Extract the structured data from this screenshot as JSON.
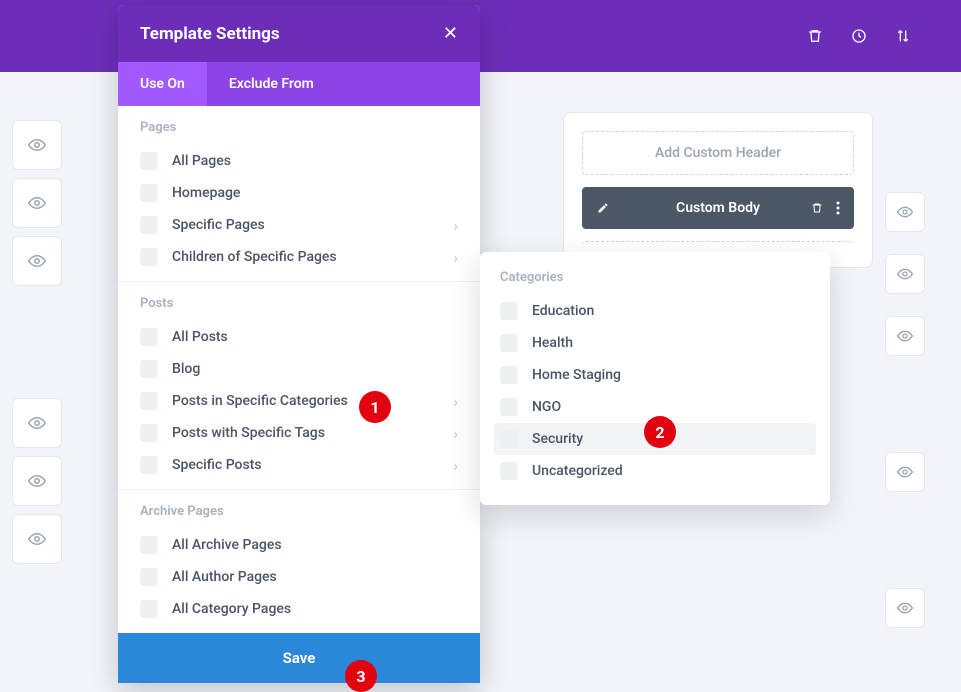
{
  "header": {
    "title": "Template Settings"
  },
  "tabs": {
    "use_on": "Use On",
    "exclude_from": "Exclude From"
  },
  "sections": {
    "pages": {
      "title": "Pages",
      "items": [
        "All Pages",
        "Homepage",
        "Specific Pages",
        "Children of Specific Pages"
      ],
      "has_chevron": [
        false,
        false,
        true,
        true
      ]
    },
    "posts": {
      "title": "Posts",
      "items": [
        "All Posts",
        "Blog",
        "Posts in Specific Categories",
        "Posts with Specific Tags",
        "Specific Posts"
      ],
      "has_chevron": [
        false,
        false,
        true,
        true,
        true
      ]
    },
    "archive": {
      "title": "Archive Pages",
      "items": [
        "All Archive Pages",
        "All Author Pages",
        "All Category Pages"
      ]
    }
  },
  "save_label": "Save",
  "flyout": {
    "title": "Categories",
    "items": [
      "Education",
      "Health",
      "Home Staging",
      "NGO",
      "Security",
      "Uncategorized"
    ],
    "highlighted_index": 4
  },
  "bg_right": {
    "add_header": "Add Custom Header",
    "custom_body": "Custom Body"
  },
  "annotations": [
    "1",
    "2",
    "3"
  ]
}
